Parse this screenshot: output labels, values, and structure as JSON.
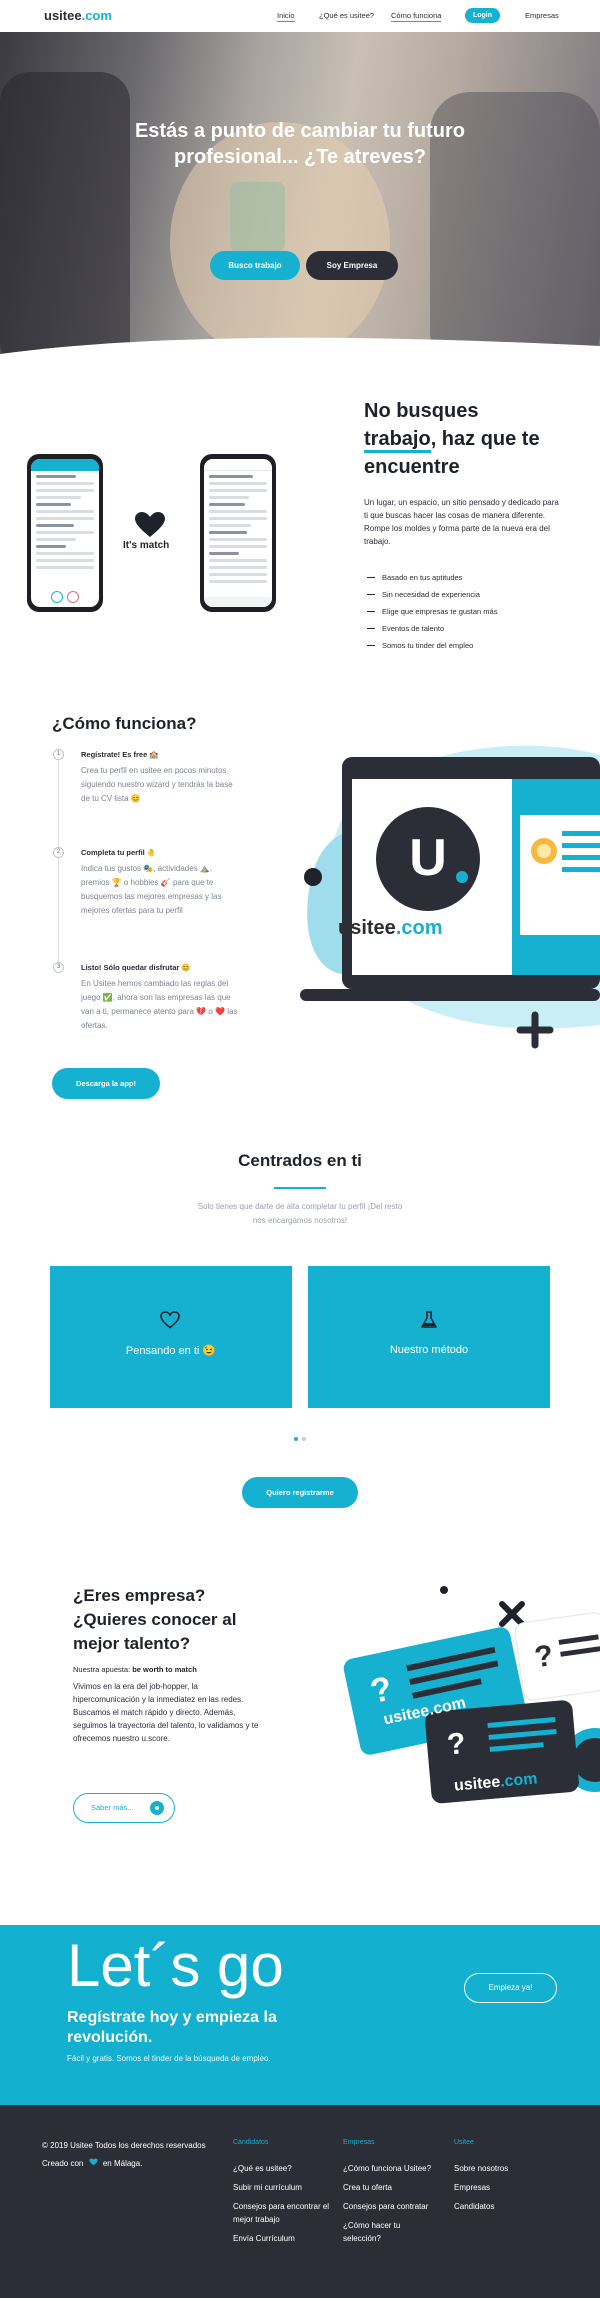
{
  "header": {
    "logo": {
      "brand": "usitee",
      "dot": ".com"
    },
    "nav": [
      "Inicio",
      "¿Qué es usitee?",
      "Cómo funciona"
    ],
    "login": "Login",
    "empresas": "Empresas"
  },
  "hero": {
    "title": "Estás a punto de cambiar tu futuro profesional... ¿Te atreves?",
    "btn_trabajo": "Busco trabajo",
    "btn_empresa": "Soy Empresa"
  },
  "match": {
    "its_match": "It's match",
    "title_a": "No busques",
    "title_b": "trabajo",
    "title_c": ", haz que te encuentre",
    "desc": "Un lugar, un espacio, un sitio pensado y dedicado para ti que buscas hacer las cosas de manera diferente. Rompe los moldes y forma parte de la nueva era del trabajo.",
    "checks": [
      "Basado en tus aptitudes",
      "Sin necesidad de experiencia",
      "Elige que empresas te gustan más",
      "Eventos de talento",
      "Somos tu tinder del empleo"
    ]
  },
  "como": {
    "title": "¿Cómo funciona?",
    "steps": [
      {
        "n": "1",
        "title": "Regístrate! Es free 🏫",
        "desc": "Crea tu perfil en usitee en pocos minutos siguiendo nuestro wizard y tendrás la base de tu CV lista 😊"
      },
      {
        "n": "2",
        "title": "Completa tu perfil 🤚",
        "desc": "Indica tus gustos 🎭, actividades ⛰️, premios 🏆 o hobbies 🎸 para que te busquemos las mejores empresas y las mejores ofertas para tu perfil"
      },
      {
        "n": "3",
        "title": "Listo! Sólo quedar disfrutar 😊",
        "desc": "En Usitee hemos cambiado las reglas del juego ✅, ahora son las empresas las que van a ti, permanece atento para 💔 o ❤️ las ofertas."
      }
    ],
    "cta": "Descarga la app!",
    "brand_text": "usitee",
    "brand_dot": ".com"
  },
  "centrados": {
    "title": "Centrados en ti",
    "subtitle": "Solo tienes que darte de alta completar tu perfil ¡Del resto nos encargamos nosotros!",
    "card1": "Pensando en ti 😉",
    "card2": "Nuestro método",
    "cta": "Quiero registrarme"
  },
  "empresa": {
    "title": "¿Eres empresa? ¿Quieres conocer al mejor talento?",
    "apuesta_label": "Nuestra apuesta:",
    "apuesta_value": "be worth to match",
    "desc": "Vivimos en la era del job-hopper, la hipercomunicación y la inmediatez en las redes. Buscamos el match rápido y directo. Además, seguimos la trayectoria del talento, lo validamos y te ofrecemos nuestro u.score.",
    "cta": "Saber más...",
    "card_brand": "usitee",
    "card_dot": ".com",
    "card_mark": "?"
  },
  "letsgo": {
    "big": "Let´s go",
    "sub": "Regístrate hoy y empieza la revolución.",
    "small": "Fácil y gratis. Somos el tinder de la búsqueda de empleo.",
    "btn": "Empieza ya!"
  },
  "footer": {
    "copy": "© 2019 Usitee Todos los derechos reservados",
    "made_a": "Creado con",
    "made_b": "en Málaga.",
    "cols": [
      {
        "title": "Candidatos",
        "links": [
          "¿Qué es usitee?",
          "Subir mi currículum",
          "Consejos para encontrar el mejor trabajo",
          "Envía Currículum"
        ]
      },
      {
        "title": "Empresas",
        "links": [
          "¿Cómo funciona Usitee?",
          "Crea tu oferta",
          "Consejos para contratar",
          "¿Cómo hacer tu selección?"
        ]
      },
      {
        "title": "Usitee",
        "links": [
          "Sobre nosotros",
          "Empresas",
          "Candidatos"
        ]
      }
    ]
  },
  "colors": {
    "accent": "#16b1d1",
    "dark": "#2b2e36"
  }
}
